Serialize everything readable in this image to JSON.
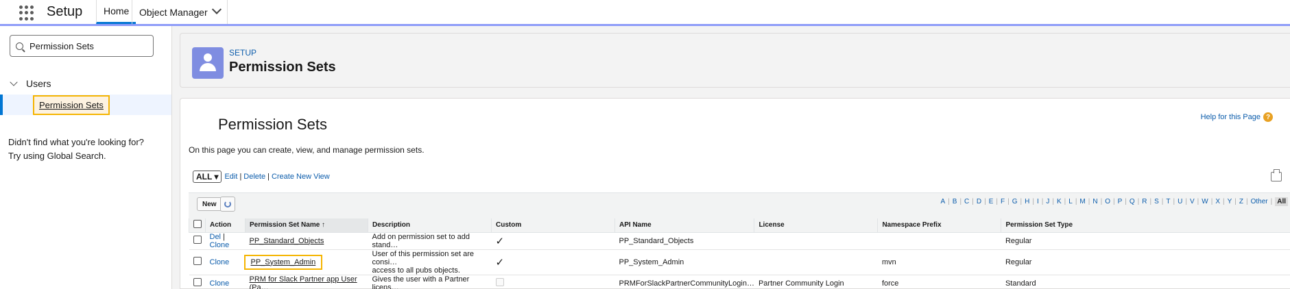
{
  "topbar": {
    "app_name": "Setup",
    "tabs": [
      {
        "label": "Home"
      },
      {
        "label": "Object Manager"
      }
    ]
  },
  "sidebar": {
    "search_value": "Permission Sets",
    "tree_parent": "Users",
    "active_item": "Permission Sets",
    "not_found_line1": "Didn't find what you're looking for?",
    "not_found_line2": "Try using Global Search."
  },
  "header": {
    "eyebrow": "SETUP",
    "title": "Permission Sets"
  },
  "main": {
    "heading": "Permission Sets",
    "help_link": "Help for this Page",
    "description": "On this page you can create, view, and manage permission sets.",
    "view_select": "ALL",
    "view_links": {
      "edit": "Edit",
      "delete": "Delete",
      "create": "Create New View"
    },
    "new_button": "New",
    "alpha": [
      "A",
      "B",
      "C",
      "D",
      "E",
      "F",
      "G",
      "H",
      "I",
      "J",
      "K",
      "L",
      "M",
      "N",
      "O",
      "P",
      "Q",
      "R",
      "S",
      "T",
      "U",
      "V",
      "W",
      "X",
      "Y",
      "Z",
      "Other",
      "All"
    ],
    "columns": {
      "action": "Action",
      "name": "Permission Set Name",
      "sort_arrow": "↑",
      "description": "Description",
      "custom": "Custom",
      "api": "API Name",
      "license": "License",
      "namespace": "Namespace Prefix",
      "type": "Permission Set Type"
    },
    "rows": [
      {
        "del": "Del",
        "clone": "Clone",
        "name": "PP_Standard_Objects",
        "description": "Add on permission set to add stand…",
        "custom": true,
        "api": "PP_Standard_Objects",
        "license": "",
        "namespace": "",
        "type": "Regular"
      },
      {
        "del": "",
        "clone": "Clone",
        "name": "PP_System_Admin",
        "description_l1": "User of this permission set are consi…",
        "description_l2": "access to all pubs objects.",
        "custom": true,
        "api": "PP_System_Admin",
        "license": "",
        "namespace": "mvn",
        "type": "Regular"
      },
      {
        "del": "",
        "clone": "Clone",
        "name": "PRM for Slack Partner app User (Pa…",
        "description": "Gives the user with a Partner licens…",
        "custom": false,
        "api": "PRMForSlackPartnerCommunityLogin…",
        "license": "Partner Community Login",
        "namespace": "force",
        "type": "Standard"
      }
    ]
  }
}
